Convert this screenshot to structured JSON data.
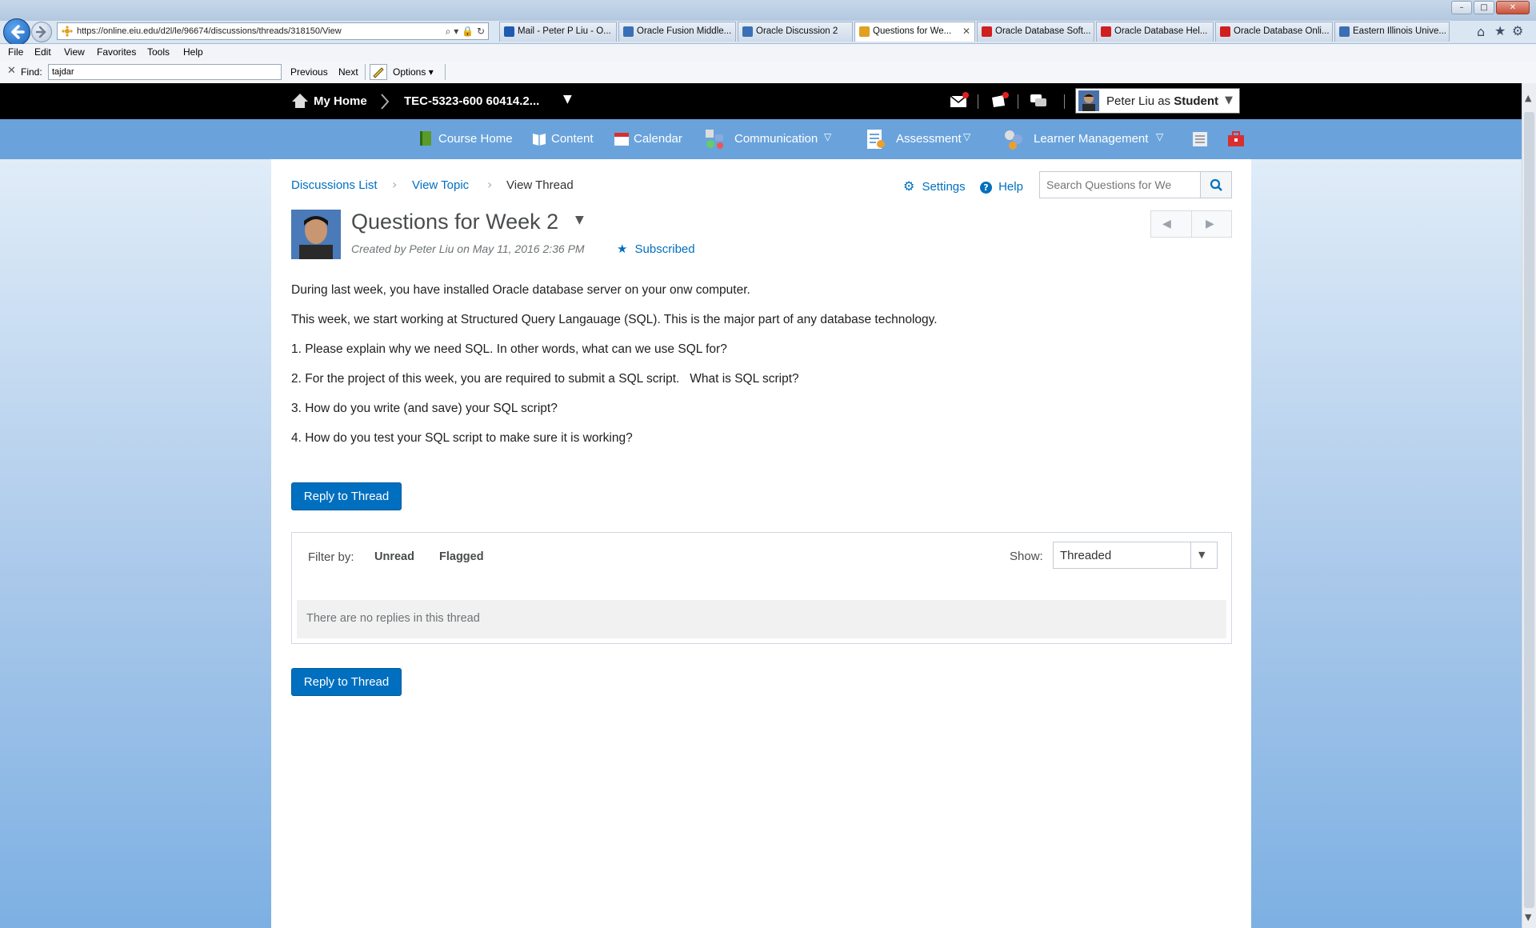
{
  "browser": {
    "back_tooltip": "Back",
    "address_url": "https://online.eiu.edu/d2l/le/96674/discussions/threads/318150/View",
    "tabs": [
      {
        "label": "Mail - Peter P Liu - O...",
        "icon_color": "#1e5bb0"
      },
      {
        "label": "Oracle Fusion Middle...",
        "icon_color": "#3a6fb5"
      },
      {
        "label": "Oracle Discussion 2",
        "icon_color": "#3a6fb5"
      },
      {
        "label": "Questions for We...",
        "icon_color": "#e0a020",
        "active": true
      },
      {
        "label": "Oracle Database Soft...",
        "icon_color": "#d01f1f"
      },
      {
        "label": "Oracle Database Hel...",
        "icon_color": "#d01f1f"
      },
      {
        "label": "Oracle Database Onli...",
        "icon_color": "#d01f1f"
      },
      {
        "label": "Eastern Illinois Unive...",
        "icon_color": "#3a6fb5"
      }
    ],
    "menu": [
      "File",
      "Edit",
      "View",
      "Favorites",
      "Tools",
      "Help"
    ],
    "find": {
      "label": "Find:",
      "value": "tajdar",
      "previous": "Previous",
      "next": "Next",
      "options": "Options"
    }
  },
  "d2l": {
    "my_home": "My Home",
    "course": "TEC-5323-600 60414.2...",
    "user_name": "Peter Liu as",
    "user_role": "Student",
    "nav": [
      "Course Home",
      "Content",
      "Calendar",
      "Communication",
      "Assessment",
      "Learner Management"
    ]
  },
  "page": {
    "breadcrumbs": [
      "Discussions List",
      "View Topic",
      "View Thread"
    ],
    "settings": "Settings",
    "help": "Help",
    "search_placeholder": "Search Questions for We",
    "title": "Questions for Week 2",
    "created_by": "Created by Peter Liu on May 11, 2016 2:36 PM",
    "subscribed": "Subscribed",
    "body": [
      "During last week, you have installed Oracle database server on your onw computer.",
      "This week, we start working at Structured Query Langauage (SQL). This is the major part of any database technology.",
      "1. Please explain why we need SQL. In other words, what can we use SQL for?",
      "2. For the project of this week, you are required to submit a SQL script.   What is SQL script?",
      "3. How do you write (and save) your SQL script?",
      "4. How do you test your SQL script to make sure it is working?"
    ],
    "reply_button": "Reply to Thread",
    "filter_by": "Filter by:",
    "filter_unread": "Unread",
    "filter_flagged": "Flagged",
    "show_label": "Show:",
    "show_value": "Threaded",
    "no_replies": "There are no replies in this thread"
  },
  "colors": {
    "accent": "#006fbf",
    "nav_blue": "#6aa3dc",
    "notification_red": "#e02020"
  }
}
